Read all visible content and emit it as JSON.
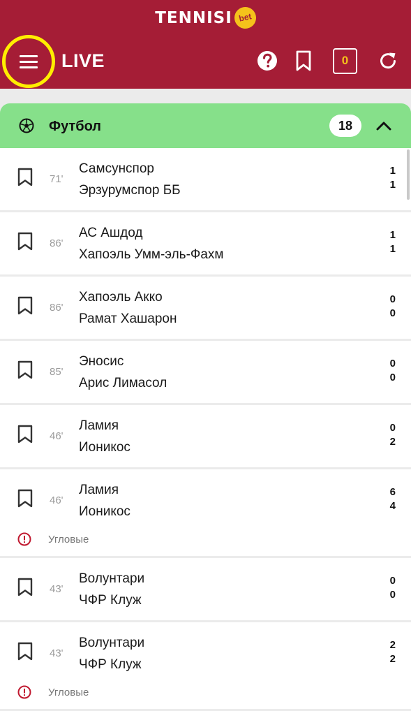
{
  "header": {
    "brand": "TENNISI",
    "brand_badge": "bet",
    "title": "LIVE",
    "coupon_count": "0",
    "colors": {
      "background": "#a51d36",
      "accent": "#f5c21b",
      "highlight_ring": "#ffee00"
    },
    "icons": [
      "menu-icon",
      "help-icon",
      "bookmark-icon",
      "coupon-icon",
      "refresh-icon"
    ]
  },
  "sport": {
    "name": "Футбол",
    "count": "18",
    "icon": "soccer-ball-icon",
    "color": "#86e08a"
  },
  "matches": [
    {
      "minute": "71'",
      "team1": "Самсунспор",
      "team2": "Эрзурумспор ББ",
      "score1": "1",
      "score2": "1"
    },
    {
      "minute": "86'",
      "team1": "АС Ашдод",
      "team2": "Хапоэль Умм-эль-Фахм",
      "score1": "1",
      "score2": "1"
    },
    {
      "minute": "86'",
      "team1": "Хапоэль Акко",
      "team2": "Рамат Хашарон",
      "score1": "0",
      "score2": "0"
    },
    {
      "minute": "85'",
      "team1": "Эносис",
      "team2": "Арис Лимасол",
      "score1": "0",
      "score2": "0"
    },
    {
      "minute": "46'",
      "team1": "Ламия",
      "team2": "Ионикос",
      "score1": "0",
      "score2": "2"
    },
    {
      "minute": "46'",
      "team1": "Ламия",
      "team2": "Ионикос",
      "score1": "6",
      "score2": "4",
      "market": "Угловые"
    },
    {
      "minute": "43'",
      "team1": "Волунтари",
      "team2": "ЧФР Клуж",
      "score1": "0",
      "score2": "0"
    },
    {
      "minute": "43'",
      "team1": "Волунтари",
      "team2": "ЧФР Клуж",
      "score1": "2",
      "score2": "2",
      "market": "Угловые"
    }
  ]
}
